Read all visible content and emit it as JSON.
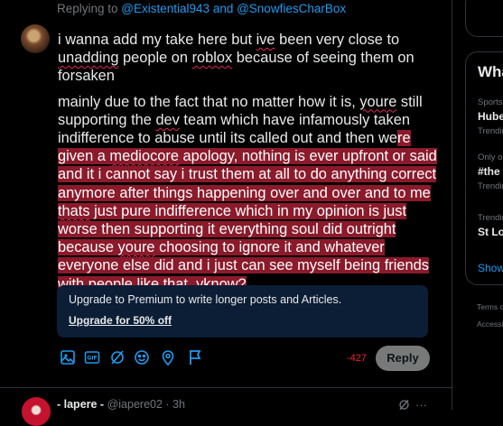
{
  "reply_context": {
    "prefix": "Replying to ",
    "handle1": "@Existential943",
    "joiner": " and ",
    "handle2": "@SnowfiesCharBox"
  },
  "composer": {
    "paragraph1": {
      "t1": "i wanna add my take here but ",
      "w1": "ive",
      "t2": " been very close to ",
      "w2": "unadding",
      "t3": " people on ",
      "w3": "roblox",
      "t4": " because of seeing them on forsaken"
    },
    "paragraph2": {
      "t1": "mainly due to the fact that no matter how it is, ",
      "w1": "youre",
      "t2": " still supporting the ",
      "w2": "dev",
      "t3": " team which have infamously taken indifference to abuse until its called out and then we",
      "o1": "re given a ",
      "o2": "mediocore",
      "o3": " apology, nothing is ever upfront or said and it i cannot say i trust them at all to do anything correct anymore after things happening over and over and to me ",
      "o4": "thats",
      "o5": " just pure indifference which in my opinion is just worse then supporting it everything soul did outright because ",
      "o6": "youre",
      "o7": " choosing to ignore it and whatever everyone else did and i just can see myself being friends with people like that, ",
      "o8": "yknow",
      "o9": "?"
    }
  },
  "premium_banner": {
    "message": "Upgrade to Premium to write longer posts and Articles.",
    "cta": "Upgrade for 50% off"
  },
  "toolbar": {
    "icons": [
      "image-icon",
      "gif-icon",
      "grok-icon",
      "emoji-icon",
      "location-icon",
      "schedule-icon"
    ]
  },
  "char_counter": "-427",
  "reply_button": "Reply",
  "next_post": {
    "name": "- lapere -",
    "handle_time": "@iapere02 · 3h",
    "more": "···"
  },
  "sidebar": {
    "trends_title": "What's happening",
    "trends": [
      {
        "context": "Sports · Trending",
        "name": "Hube",
        "meta": "Trending"
      },
      {
        "context": "Only on X · Trending",
        "name": "#the",
        "meta": "Trending"
      },
      {
        "context": "Trending in",
        "name": "St Lo",
        "meta": ""
      }
    ],
    "show_more": "Show more",
    "footer1": "Terms of",
    "footer2": "Accessib"
  },
  "colors": {
    "accent": "#1d9bf0",
    "over_limit_highlight": "#8b1a2b",
    "error": "#f4212e",
    "premium_bg": "#0c1e36"
  }
}
